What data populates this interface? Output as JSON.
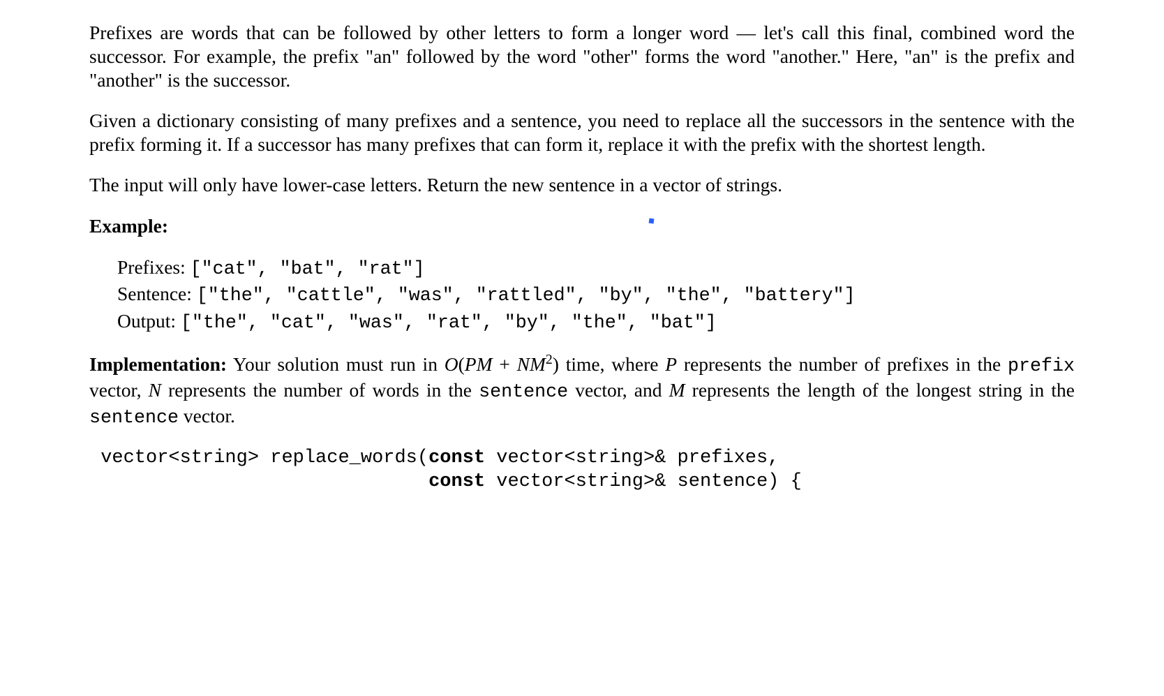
{
  "doc": {
    "para1": "Prefixes are words that can be followed by other letters to form a longer word — let's call this final, combined word the successor. For example, the prefix \"an\" followed by the word \"other\" forms the word \"another.\" Here, \"an\" is the prefix and \"another\" is the successor.",
    "para2": "Given a dictionary consisting of many prefixes and a sentence, you need to replace all the successors in the sentence with the prefix forming it. If a successor has many prefixes that can form it, replace it with the prefix with the shortest length.",
    "para3": "The input will only have lower-case letters. Return the new sentence in a vector of strings.",
    "example_label": "Example:",
    "example": {
      "prefixes_label": "Prefixes: ",
      "prefixes_value": "[\"cat\", \"bat\", \"rat\"]",
      "sentence_label": "Sentence: ",
      "sentence_value": "[\"the\", \"cattle\", \"was\", \"rattled\", \"by\", \"the\", \"battery\"]",
      "output_label": "Output: ",
      "output_value": "[\"the\", \"cat\", \"was\", \"rat\", \"by\", \"the\", \"bat\"]"
    },
    "impl": {
      "label": "Implementation:",
      "text1": "  Your solution must run in ",
      "bigO_open": "O",
      "bigO_expr_a": "(",
      "bigO_P": "P",
      "bigO_M1": "M",
      "bigO_plus": " + ",
      "bigO_N": "N",
      "bigO_M2": "M",
      "bigO_sup": "2",
      "bigO_close": ")",
      "text2": " time, where ",
      "var_P": "P",
      "text3": " represents the number of prefixes in the ",
      "code_prefix": "prefix",
      "text4": " vector, ",
      "var_N": "N",
      "text5": " represents the number of words in the ",
      "code_sentence": "sentence",
      "text6": " vector, and ",
      "var_M": "M",
      "text7": " represents the length of the longest string in the ",
      "code_sentence2": "sentence",
      "text8": " vector."
    },
    "code": {
      "l1a": " vector<string> replace_words(",
      "l1b": "const",
      "l1c": " vector<string>& prefixes,",
      "l2a": "                              ",
      "l2b": "const",
      "l2c": " vector<string>& sentence) {"
    }
  }
}
